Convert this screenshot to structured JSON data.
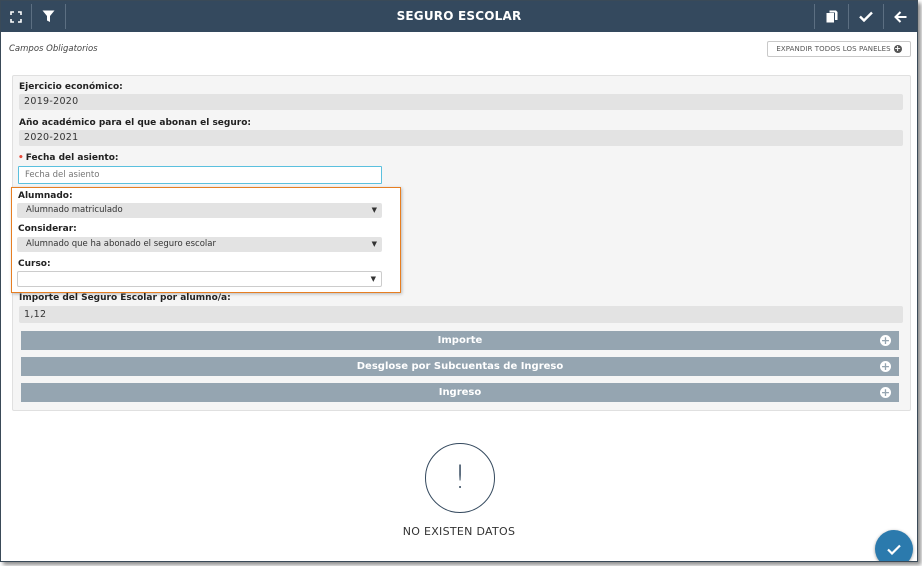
{
  "header": {
    "title": "SEGURO ESCOLAR",
    "left_icons": [
      "fullscreen-icon",
      "filter-icon"
    ],
    "right_icons": [
      "copy-icon",
      "check-icon",
      "arrow-left-icon"
    ],
    "bg_color": "#34495e"
  },
  "required_note": "Campos Obligatorios",
  "expand_button": {
    "label": "EXPANDIR TODOS LOS PANELES",
    "icon": "plus-circle-icon"
  },
  "form": {
    "ejercicio": {
      "label": "Ejercicio económico:",
      "value": "2019-2020"
    },
    "anio_academico": {
      "label": "Año académico para el que abonan el seguro:",
      "value": "2020-2021"
    },
    "fecha_asiento": {
      "label": "Fecha del asiento:",
      "placeholder": "Fecha del asiento",
      "required": true
    },
    "alumnado": {
      "label": "Alumnado:",
      "selected": "Alumnado matriculado"
    },
    "considerar": {
      "label": "Considerar:",
      "selected": "Alumnado que ha abonado el seguro escolar"
    },
    "curso": {
      "label": "Curso:",
      "selected": ""
    },
    "importe_seguro": {
      "label": "Importe del Seguro Escolar por alumno/a:",
      "value": "1,12"
    }
  },
  "sections": [
    {
      "label": "Importe"
    },
    {
      "label": "Desglose por Subcuentas de Ingreso"
    },
    {
      "label": "Ingreso"
    }
  ],
  "empty_state": {
    "icon": "exclamation-icon",
    "symbol": "!",
    "text": "NO EXISTEN DATOS"
  },
  "fab": {
    "icon": "check-icon"
  },
  "colors": {
    "accent": "#2b7aad",
    "highlight_border": "#e67e22",
    "section_bar": "#95a5b1",
    "required": "#e74c3c"
  }
}
